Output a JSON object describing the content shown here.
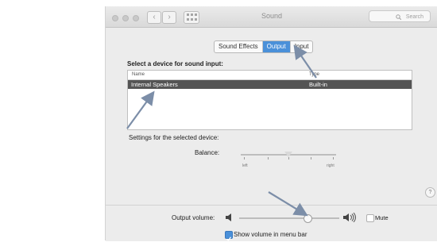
{
  "window": {
    "title": "Sound",
    "search_placeholder": "Search",
    "back_glyph": "‹",
    "forward_glyph": "›"
  },
  "tabs": [
    {
      "label": "Sound Effects",
      "active": false
    },
    {
      "label": "Output",
      "active": true
    },
    {
      "label": "Input",
      "active": false
    }
  ],
  "device_section": {
    "heading": "Select a device for sound input:",
    "columns": [
      "Name",
      "Type"
    ],
    "rows": [
      {
        "name": "Internal Speakers",
        "type": "Built-in"
      }
    ]
  },
  "settings": {
    "heading": "Settings for the selected device:",
    "balance_label": "Balance:",
    "balance_left": "left",
    "balance_right": "right",
    "balance_value": 0.5
  },
  "help_glyph": "?",
  "output": {
    "volume_label": "Output volume:",
    "volume_value": 0.68,
    "mute_label": "Mute",
    "mute_checked": false,
    "menu_bar_label": "Show volume in menu bar",
    "menu_bar_checked": true
  },
  "colors": {
    "accent": "#4a90d9",
    "selection": "#545454",
    "arrow": "#7c8ea8"
  },
  "icons": [
    "search-icon",
    "grid-icon",
    "speaker-low-icon",
    "speaker-high-icon",
    "help-icon"
  ]
}
